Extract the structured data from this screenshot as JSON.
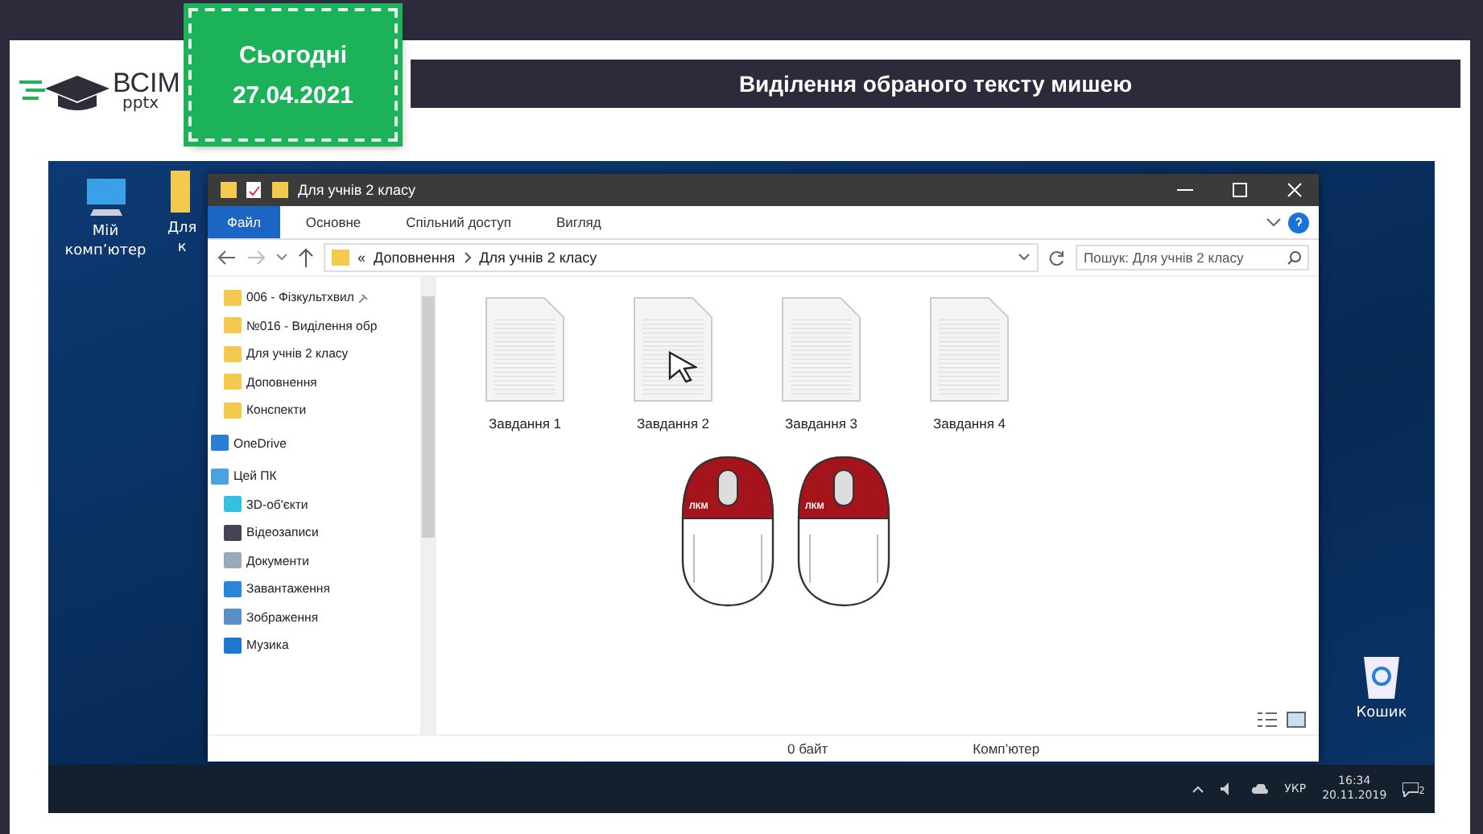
{
  "slide": {
    "logo": {
      "main": "ВСІМ",
      "sub": "pptx"
    },
    "date_label": "Сьогодні",
    "date": "27.04.2021",
    "title": "Виділення обраного тексту мишею"
  },
  "desktop": {
    "icons": [
      {
        "kind": "computer",
        "lines": [
          "Мій",
          "комп’ютер"
        ]
      },
      {
        "kind": "folder",
        "lines": [
          "Для",
          "к"
        ]
      },
      {
        "kind": "bin",
        "lines": [
          "Кошик"
        ]
      }
    ]
  },
  "explorer": {
    "title": "Для учнів 2 класу",
    "ribbon_tabs": [
      {
        "label": "Файл",
        "selected": true
      },
      {
        "label": "Основне",
        "selected": false
      },
      {
        "label": "Спільний доступ",
        "selected": false
      },
      {
        "label": "Вигляд",
        "selected": false
      }
    ],
    "breadcrumb": [
      "Доповнення",
      "Для учнів 2 класу"
    ],
    "breadcrumb_lead": "«",
    "search": {
      "placeholder": "Пошук: Для учнів 2 класу"
    },
    "nav_items": [
      {
        "label": "006 - Фізкультхвил",
        "kind": "folder",
        "pinned": true
      },
      {
        "label": "№016 - Виділення обр",
        "kind": "folder",
        "pinned": false
      },
      {
        "label": "Для учнів 2 класу",
        "kind": "folder",
        "pinned": false
      },
      {
        "label": "Доповнення",
        "kind": "folder",
        "pinned": false
      },
      {
        "label": "Конспекти",
        "kind": "folder",
        "pinned": false
      },
      {
        "label": "OneDrive",
        "kind": "cloud",
        "pinned": false
      },
      {
        "label": "Цей ПК",
        "kind": "pc",
        "pinned": false,
        "children": [
          {
            "label": "3D-об'єкти",
            "kind": "cube"
          },
          {
            "label": "Відеозаписи",
            "kind": "video"
          },
          {
            "label": "Документи",
            "kind": "doc"
          },
          {
            "label": "Завантаження",
            "kind": "download"
          },
          {
            "label": "Зображення",
            "kind": "image"
          },
          {
            "label": "Музика",
            "kind": "music"
          }
        ]
      }
    ],
    "files": [
      {
        "name": "Завдання 1",
        "pointer": false
      },
      {
        "name": "Завдання 2",
        "pointer": true
      },
      {
        "name": "Завдання 3",
        "pointer": false
      },
      {
        "name": "Завдання 4",
        "pointer": false
      }
    ],
    "mice": [
      {
        "label": "ЛКМ"
      },
      {
        "label": "ЛКМ"
      }
    ],
    "status_bar": [
      "0 байт",
      "Комп’ютер"
    ]
  },
  "taskbar": {
    "language": "УКР",
    "time": "16:34",
    "date": "20.11.2019",
    "notifications": "2"
  }
}
